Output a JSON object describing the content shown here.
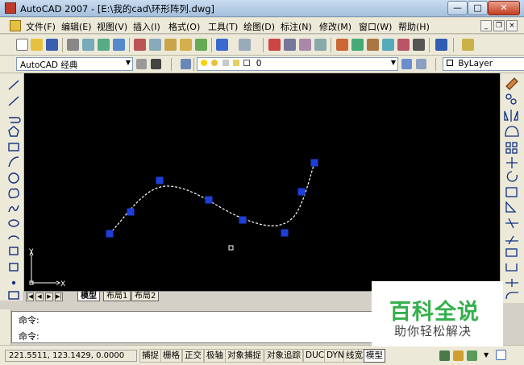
{
  "window": {
    "title": "AutoCAD 2007 - [E:\\我的cad\\环形阵列.dwg]"
  },
  "menu": {
    "items": [
      "文件(F)",
      "编辑(E)",
      "视图(V)",
      "插入(I)",
      "格式(O)",
      "工具(T)",
      "绘图(D)",
      "标注(N)",
      "修改(M)",
      "窗口(W)",
      "帮助(H)"
    ]
  },
  "toolbar2": {
    "workspace": "AutoCAD 经典",
    "layer_value": "0",
    "color_value": "ByLayer"
  },
  "axes": {
    "y_label": "Y",
    "x_label": "X"
  },
  "layout_tabs": {
    "tabs": [
      "模型",
      "布局1",
      "布局2"
    ],
    "active": "模型"
  },
  "command": {
    "line1": "命令:",
    "line2": "命令:"
  },
  "status": {
    "coords": "221.5511, 123.1429, 0.0000",
    "buttons": [
      "捕捉",
      "栅格",
      "正交",
      "极轴",
      "对象捕捉",
      "对象追踪",
      "DUCS",
      "DYN",
      "线宽",
      "模型"
    ]
  },
  "watermark": {
    "title": "百科全说",
    "subtitle": "助你轻松解决"
  },
  "colors": {
    "grip": "#1c3fd8",
    "canvas": "#000000",
    "curve": "#ffffff"
  }
}
